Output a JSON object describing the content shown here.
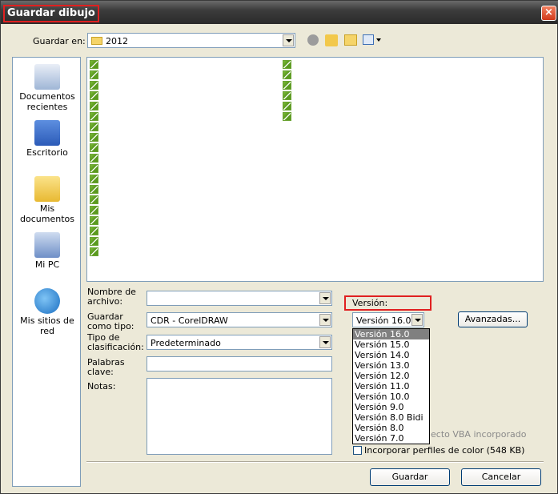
{
  "window": {
    "title": "Guardar dibujo",
    "close": "×"
  },
  "save_in": {
    "label": "Guardar en:",
    "value": "2012"
  },
  "places": [
    {
      "label": "Documentos recientes"
    },
    {
      "label": "Escritorio"
    },
    {
      "label": "Mis documentos"
    },
    {
      "label": "Mi PC"
    },
    {
      "label": "Mis sitios de red"
    }
  ],
  "form": {
    "filename_label": "Nombre de archivo:",
    "filename_value": "",
    "save_as_label": "Guardar como tipo:",
    "save_as_value": "CDR - CorelDRAW",
    "rating_label": "Tipo de clasificación:",
    "rating_value": "Predeterminado",
    "keywords_label": "Palabras clave:",
    "keywords_value": "",
    "notes_label": "Notas:",
    "notes_value": ""
  },
  "version": {
    "label": "Versión:",
    "value": "Versión 16.0",
    "options": [
      "Versión 16.0",
      "Versión 15.0",
      "Versión 14.0",
      "Versión 13.0",
      "Versión 12.0",
      "Versión 11.0",
      "Versión 10.0",
      "Versión 9.0",
      "Versión 8.0 Bidi",
      "Versión 8.0",
      "Versión 7.0"
    ]
  },
  "advanced_button": "Avanzadas...",
  "embed_vba": "ecto VBA incorporado",
  "embed_color_profiles": "Incorporar perfiles de color (548 KB)",
  "buttons": {
    "save": "Guardar",
    "cancel": "Cancelar"
  }
}
